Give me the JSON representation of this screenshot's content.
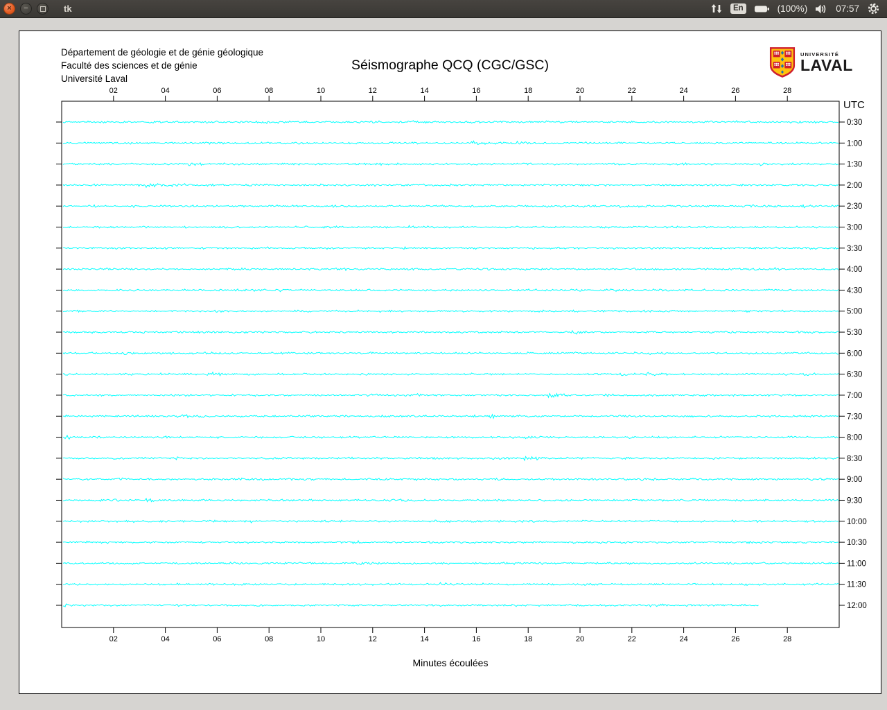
{
  "titlebar": {
    "window_title": "tk",
    "indicators": {
      "keyboard_layout": "En",
      "battery_text": "(100%)",
      "clock": "07:57"
    }
  },
  "page": {
    "address_lines": [
      "Département de géologie et de génie géologique",
      "Faculté des sciences et de génie",
      "Université Laval"
    ],
    "title": "Séismographe QCQ (CGC/GSC)",
    "logo": {
      "line1": "UNIVERSITÉ",
      "line2": "LAVAL"
    }
  },
  "chart_data": {
    "type": "line",
    "subtype": "seismograph-heliplot",
    "title": "Séismographe QCQ (CGC/GSC)",
    "station": "QCQ (CGC/GSC)",
    "xlabel": "Minutes écoulées",
    "x_range": [
      0,
      30
    ],
    "x_ticks": [
      "02",
      "04",
      "06",
      "08",
      "10",
      "12",
      "14",
      "16",
      "18",
      "20",
      "22",
      "24",
      "26",
      "28"
    ],
    "right_axis_label": "UTC",
    "right_axis_color": "#ff0000",
    "trace_color": "#00ffff",
    "minutes_per_line": 30,
    "grid": false,
    "description": "24 half-hour seismic noise traces, low-amplitude background noise, no large events; last trace (12:00) is still being written and stops near minute 27.",
    "traces": [
      {
        "utc": "0:30",
        "start_min": 0,
        "end_min": 30
      },
      {
        "utc": "1:00",
        "start_min": 0,
        "end_min": 30
      },
      {
        "utc": "1:30",
        "start_min": 0,
        "end_min": 30
      },
      {
        "utc": "2:00",
        "start_min": 0,
        "end_min": 30
      },
      {
        "utc": "2:30",
        "start_min": 0,
        "end_min": 30
      },
      {
        "utc": "3:00",
        "start_min": 0,
        "end_min": 30
      },
      {
        "utc": "3:30",
        "start_min": 0,
        "end_min": 30
      },
      {
        "utc": "4:00",
        "start_min": 0,
        "end_min": 30
      },
      {
        "utc": "4:30",
        "start_min": 0,
        "end_min": 30
      },
      {
        "utc": "5:00",
        "start_min": 0,
        "end_min": 30
      },
      {
        "utc": "5:30",
        "start_min": 0,
        "end_min": 30
      },
      {
        "utc": "6:00",
        "start_min": 0,
        "end_min": 30
      },
      {
        "utc": "6:30",
        "start_min": 0,
        "end_min": 30
      },
      {
        "utc": "7:00",
        "start_min": 0,
        "end_min": 30
      },
      {
        "utc": "7:30",
        "start_min": 0,
        "end_min": 30
      },
      {
        "utc": "8:00",
        "start_min": 0,
        "end_min": 30
      },
      {
        "utc": "8:30",
        "start_min": 0,
        "end_min": 30
      },
      {
        "utc": "9:00",
        "start_min": 0,
        "end_min": 30
      },
      {
        "utc": "9:30",
        "start_min": 0,
        "end_min": 30
      },
      {
        "utc": "10:00",
        "start_min": 0,
        "end_min": 30
      },
      {
        "utc": "10:30",
        "start_min": 0,
        "end_min": 30
      },
      {
        "utc": "11:00",
        "start_min": 0,
        "end_min": 30
      },
      {
        "utc": "11:30",
        "start_min": 0,
        "end_min": 30
      },
      {
        "utc": "12:00",
        "start_min": 0,
        "end_min": 26.9
      }
    ]
  }
}
